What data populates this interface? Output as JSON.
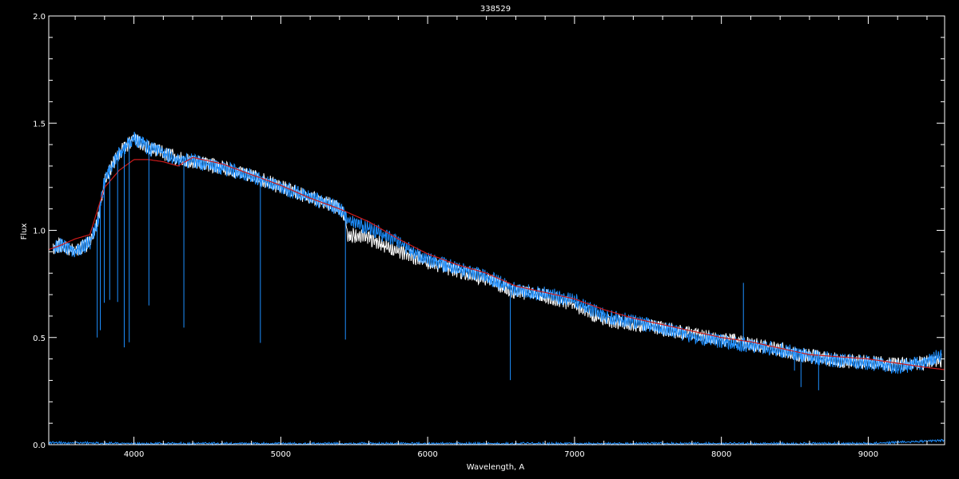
{
  "chart_data": {
    "type": "line",
    "title": "338529",
    "xlabel": "Wavelength, A",
    "ylabel": "Flux",
    "xlim": [
      3420,
      9520
    ],
    "ylim": [
      0,
      2.0
    ],
    "x_ticks": [
      4000,
      5000,
      6000,
      7000,
      8000,
      9000
    ],
    "x_tick_labels": [
      "4000",
      "5000",
      "6000",
      "7000",
      "8000",
      "9000"
    ],
    "y_ticks": [
      0,
      0.5,
      1.0,
      1.5,
      2.0
    ],
    "y_tick_labels": [
      "0.0",
      "0.5",
      "1.0",
      "1.5",
      "2.0"
    ],
    "grid": false,
    "background": "#000000",
    "series": [
      {
        "color": "#ffffff",
        "x": [
          3450,
          3500,
          3600,
          3700,
          3750,
          3800,
          3900,
          4000,
          4100,
          4200,
          4300,
          4400,
          4600,
          4800,
          5000,
          5200,
          5400,
          5440,
          5450,
          5600,
          5800,
          6000,
          6200,
          6400,
          6500,
          6600,
          6800,
          7000,
          7200,
          7400,
          7600,
          7800,
          8000,
          8200,
          8400,
          8600,
          8800,
          9000,
          9200,
          9400,
          9500
        ],
        "y": [
          0.93,
          0.95,
          0.92,
          0.96,
          1.05,
          1.25,
          1.38,
          1.45,
          1.4,
          1.38,
          1.35,
          1.34,
          1.31,
          1.27,
          1.22,
          1.17,
          1.12,
          1.09,
          1.0,
          0.98,
          0.92,
          0.87,
          0.83,
          0.79,
          0.76,
          0.73,
          0.71,
          0.67,
          0.6,
          0.58,
          0.56,
          0.53,
          0.51,
          0.49,
          0.46,
          0.43,
          0.41,
          0.4,
          0.39,
          0.4,
          0.41
        ]
      },
      {
        "color": "#1e8fff",
        "x": [
          3450,
          3500,
          3600,
          3700,
          3750,
          3800,
          3900,
          4000,
          4100,
          4200,
          4300,
          4400,
          4600,
          4800,
          5000,
          5200,
          5400,
          5440,
          5450,
          5600,
          5800,
          6000,
          6200,
          6400,
          6500,
          6600,
          6800,
          7000,
          7200,
          7400,
          7600,
          7800,
          8000,
          8200,
          8400,
          8600,
          8800,
          9000,
          9200,
          9400,
          9500
        ],
        "y": [
          0.93,
          0.95,
          0.92,
          0.96,
          1.05,
          1.25,
          1.38,
          1.45,
          1.4,
          1.38,
          1.35,
          1.34,
          1.31,
          1.27,
          1.22,
          1.17,
          1.12,
          1.09,
          1.06,
          1.03,
          0.96,
          0.88,
          0.84,
          0.8,
          0.77,
          0.74,
          0.72,
          0.69,
          0.62,
          0.59,
          0.56,
          0.52,
          0.5,
          0.48,
          0.46,
          0.43,
          0.41,
          0.4,
          0.38,
          0.4,
          0.44
        ]
      },
      {
        "color": "#cc1a1a",
        "x": [
          3420,
          3500,
          3600,
          3700,
          3800,
          3900,
          4000,
          4100,
          4200,
          4300,
          4400,
          4600,
          4800,
          5000,
          5200,
          5400,
          5600,
          5800,
          6000,
          6200,
          6400,
          6600,
          6800,
          7000,
          7200,
          7400,
          7600,
          7800,
          8000,
          8200,
          8400,
          8600,
          8800,
          9000,
          9200,
          9400,
          9520
        ],
        "y": [
          0.91,
          0.93,
          0.96,
          0.98,
          1.2,
          1.28,
          1.33,
          1.33,
          1.32,
          1.3,
          1.34,
          1.31,
          1.26,
          1.21,
          1.15,
          1.1,
          1.04,
          0.96,
          0.89,
          0.84,
          0.8,
          0.74,
          0.71,
          0.68,
          0.63,
          0.59,
          0.56,
          0.53,
          0.5,
          0.48,
          0.45,
          0.42,
          0.41,
          0.4,
          0.38,
          0.36,
          0.35
        ]
      }
    ],
    "absorption_lines": [
      {
        "x": 3750,
        "depth": 0.55,
        "color": "#1e8fff"
      },
      {
        "x": 3771,
        "depth": 0.6,
        "color": "#1e8fff"
      },
      {
        "x": 3798,
        "depth": 0.58,
        "color": "#1e8fff"
      },
      {
        "x": 3835,
        "depth": 0.62,
        "color": "#1e8fff"
      },
      {
        "x": 3889,
        "depth": 0.7,
        "color": "#1e8fff"
      },
      {
        "x": 3934,
        "depth": 0.95,
        "color": "#1e8fff"
      },
      {
        "x": 3968,
        "depth": 0.95,
        "color": "#1e8fff"
      },
      {
        "x": 4102,
        "depth": 0.75,
        "color": "#1e8fff"
      },
      {
        "x": 4340,
        "depth": 0.8,
        "color": "#1e8fff"
      },
      {
        "x": 4861,
        "depth": 0.78,
        "color": "#1e8fff"
      },
      {
        "x": 5440,
        "depth": 0.6,
        "color": "#1e8fff"
      },
      {
        "x": 6563,
        "depth": 0.45,
        "color": "#1e8fff"
      },
      {
        "x": 8150,
        "depth": -0.27,
        "color": "#1e8fff"
      },
      {
        "x": 8498,
        "depth": 0.1,
        "color": "#1e8fff"
      },
      {
        "x": 8542,
        "depth": 0.17,
        "color": "#1e8fff"
      },
      {
        "x": 8662,
        "depth": 0.17,
        "color": "#1e8fff"
      }
    ],
    "error_series": {
      "color": "#1e8fff",
      "x": [
        3420,
        4000,
        4500,
        5000,
        5500,
        6000,
        6500,
        7000,
        7500,
        8000,
        8500,
        9000,
        9520
      ],
      "y": [
        0.01,
        0.005,
        0.005,
        0.005,
        0.005,
        0.005,
        0.005,
        0.005,
        0.005,
        0.005,
        0.005,
        0.005,
        0.02
      ]
    }
  }
}
